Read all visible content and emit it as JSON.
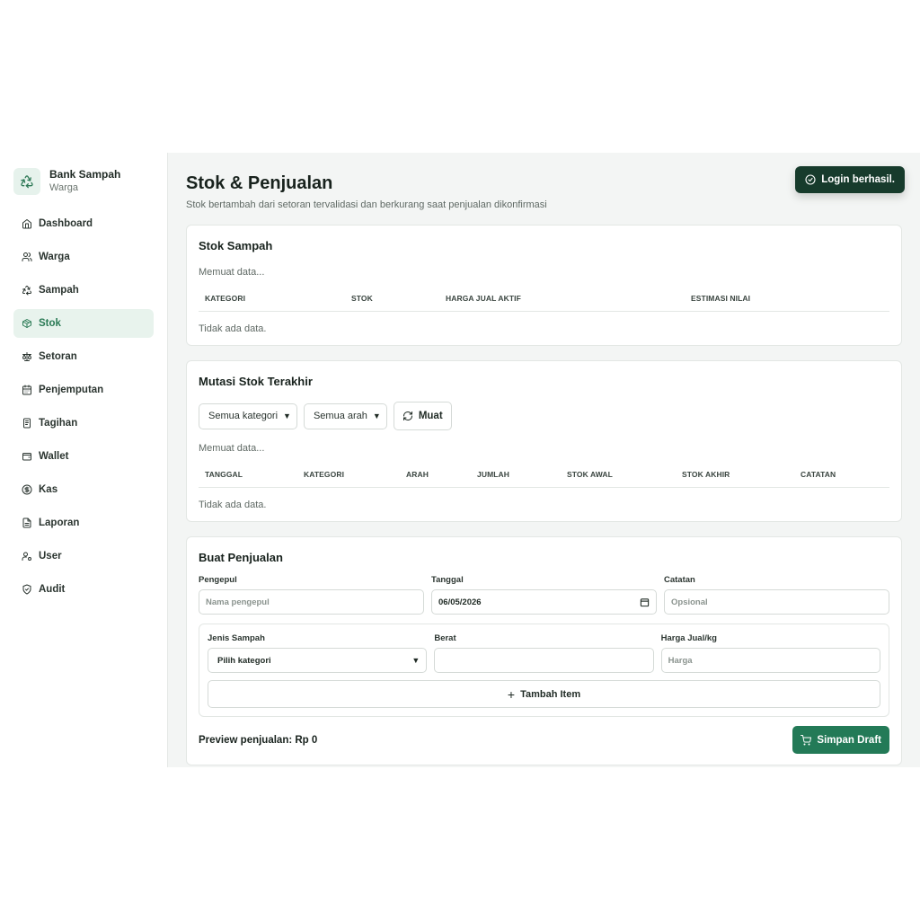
{
  "sidebar": {
    "brand_title": "Bank Sampah",
    "brand_sub": "Warga",
    "items": [
      {
        "label": "Dashboard",
        "icon": "home-icon"
      },
      {
        "label": "Warga",
        "icon": "users-icon"
      },
      {
        "label": "Sampah",
        "icon": "recycle-icon"
      },
      {
        "label": "Stok",
        "icon": "box-icon",
        "active": true
      },
      {
        "label": "Setoran",
        "icon": "scale-icon"
      },
      {
        "label": "Penjemputan",
        "icon": "calendar-icon"
      },
      {
        "label": "Tagihan",
        "icon": "receipt-icon"
      },
      {
        "label": "Wallet",
        "icon": "wallet-icon"
      },
      {
        "label": "Kas",
        "icon": "dollar-icon"
      },
      {
        "label": "Laporan",
        "icon": "file-icon"
      },
      {
        "label": "User",
        "icon": "user-key-icon"
      },
      {
        "label": "Audit",
        "icon": "shield-check-icon"
      }
    ]
  },
  "header": {
    "title": "Stok & Penjualan",
    "subtitle": "Stok bertambah dari setoran tervalidasi dan berkurang saat penjualan dikonfirmasi"
  },
  "toast": {
    "text": "Login berhasil."
  },
  "stock": {
    "title": "Stok Sampah",
    "loading": "Memuat data...",
    "columns": [
      "Kategori",
      "Stok",
      "Harga Jual Aktif",
      "Estimasi Nilai"
    ],
    "empty": "Tidak ada data."
  },
  "mutations": {
    "title": "Mutasi Stok Terakhir",
    "category_filter": "Semua kategori",
    "direction_filter": "Semua arah",
    "load_label": "Muat",
    "loading": "Memuat data...",
    "columns": [
      "Tanggal",
      "Kategori",
      "Arah",
      "Jumlah",
      "Stok Awal",
      "Stok Akhir",
      "Catatan"
    ],
    "empty": "Tidak ada data."
  },
  "sale": {
    "title": "Buat Penjualan",
    "collector_label": "Pengepul",
    "collector_placeholder": "Nama pengepul",
    "date_label": "Tanggal",
    "date_value": "06/05/2026",
    "note_label": "Catatan",
    "note_placeholder": "Opsional",
    "type_label": "Jenis Sampah",
    "type_value": "Pilih kategori",
    "weight_label": "Berat",
    "weight_value": "",
    "price_label": "Harga Jual/kg",
    "price_placeholder": "Harga",
    "add_item_label": "Tambah Item",
    "preview_label": "Preview penjualan: Rp 0",
    "save_label": "Simpan Draft"
  },
  "colors": {
    "accent": "#237a57",
    "toast_bg": "#173b2c",
    "active_bg": "#e8f3ed",
    "page_bg": "#f3f5f4"
  }
}
